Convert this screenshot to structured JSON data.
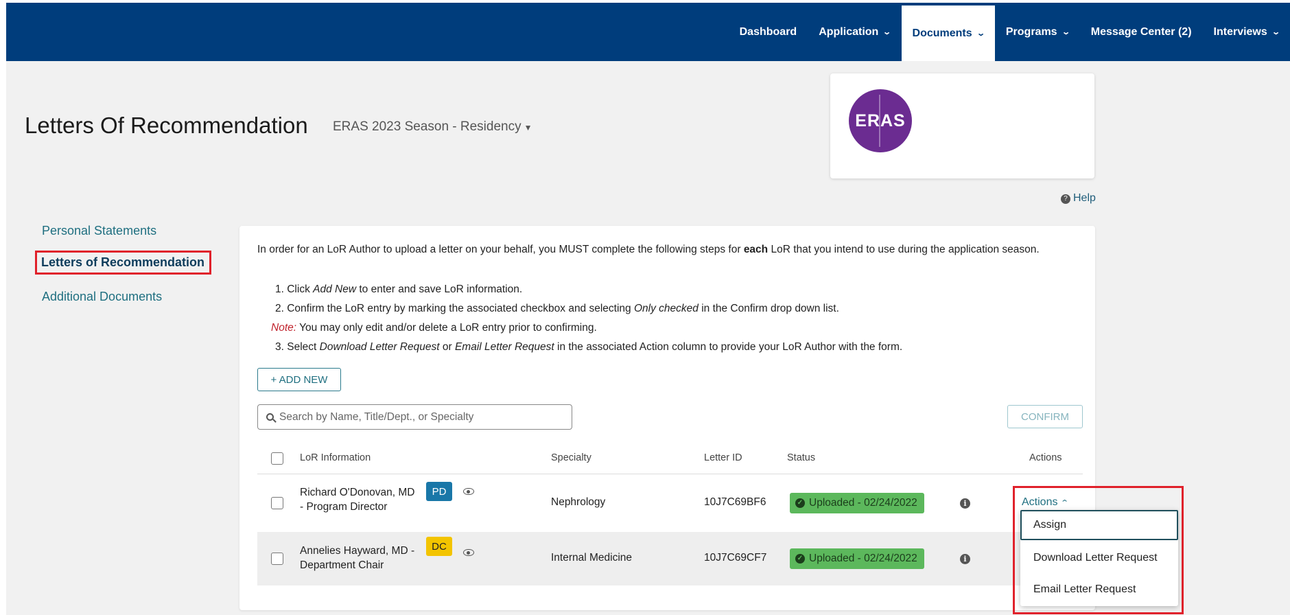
{
  "nav": {
    "items": [
      {
        "label": "Dashboard",
        "has_dropdown": false
      },
      {
        "label": "Application",
        "has_dropdown": true
      },
      {
        "label": "Documents",
        "has_dropdown": true,
        "active": true
      },
      {
        "label": "Programs",
        "has_dropdown": true
      },
      {
        "label": "Message Center (2)",
        "has_dropdown": false
      },
      {
        "label": "Interviews",
        "has_dropdown": true
      }
    ],
    "background_color": "#003d7c"
  },
  "header": {
    "title": "Letters Of Recommendation",
    "season_selector": "ERAS 2023 Season - Residency"
  },
  "logo": {
    "text": "ERAS",
    "color": "#6b2c91"
  },
  "help": {
    "label": "Help"
  },
  "sidebar": {
    "items": [
      {
        "label": "Personal Statements"
      },
      {
        "label": "Letters of Recommendation",
        "active": true
      },
      {
        "label": "Additional Documents"
      }
    ]
  },
  "instructions": {
    "intro_before": "In order for an LoR Author to upload a letter on your behalf, you MUST complete the following steps for ",
    "intro_bold": "each",
    "intro_after": " LoR that you intend to use during the application season.",
    "step1_num": "1. ",
    "step1_a": "Click ",
    "step1_em": "Add New",
    "step1_b": " to enter and save LoR information.",
    "step2_num": "2. ",
    "step2_a": "Confirm the LoR entry by marking the associated checkbox and selecting ",
    "step2_em": "Only checked",
    "step2_b": " in the Confirm drop down list.",
    "note_label": "Note:",
    "note_text": " You may only edit and/or delete a LoR entry prior to confirming.",
    "step3_num": "3. ",
    "step3_a": "Select ",
    "step3_em1": "Download Letter Request",
    "step3_or": " or ",
    "step3_em2": "Email Letter Request",
    "step3_b": " in the associated Action column to provide your LoR Author with the form."
  },
  "toolbar": {
    "add_new_label": "+ ADD NEW",
    "search_placeholder": "Search by Name, Title/Dept., or Specialty",
    "confirm_label": "CONFIRM"
  },
  "table": {
    "headers": {
      "lor_information": "LoR Information",
      "specialty": "Specialty",
      "letter_id": "Letter ID",
      "status": "Status",
      "actions": "Actions"
    },
    "rows": [
      {
        "name": "Richard O'Donovan, MD - Program Director",
        "badge": "PD",
        "specialty": "Nephrology",
        "letter_id": "10J7C69BF6",
        "status": "Uploaded - 02/24/2022",
        "actions_label": "Actions"
      },
      {
        "name": "Annelies Hayward, MD - Department Chair",
        "badge": "DC",
        "specialty": "Internal Medicine",
        "letter_id": "10J7C69CF7",
        "status": "Uploaded - 02/24/2022"
      }
    ]
  },
  "actions_menu": {
    "items": [
      "Assign",
      "Download Letter Request",
      "Email Letter Request"
    ]
  },
  "colors": {
    "accent_teal": "#1f6f80",
    "status_green": "#5cb85c",
    "highlight_red": "#e0212b",
    "badge_pd": "#1977a8",
    "badge_dc": "#f3c400"
  }
}
